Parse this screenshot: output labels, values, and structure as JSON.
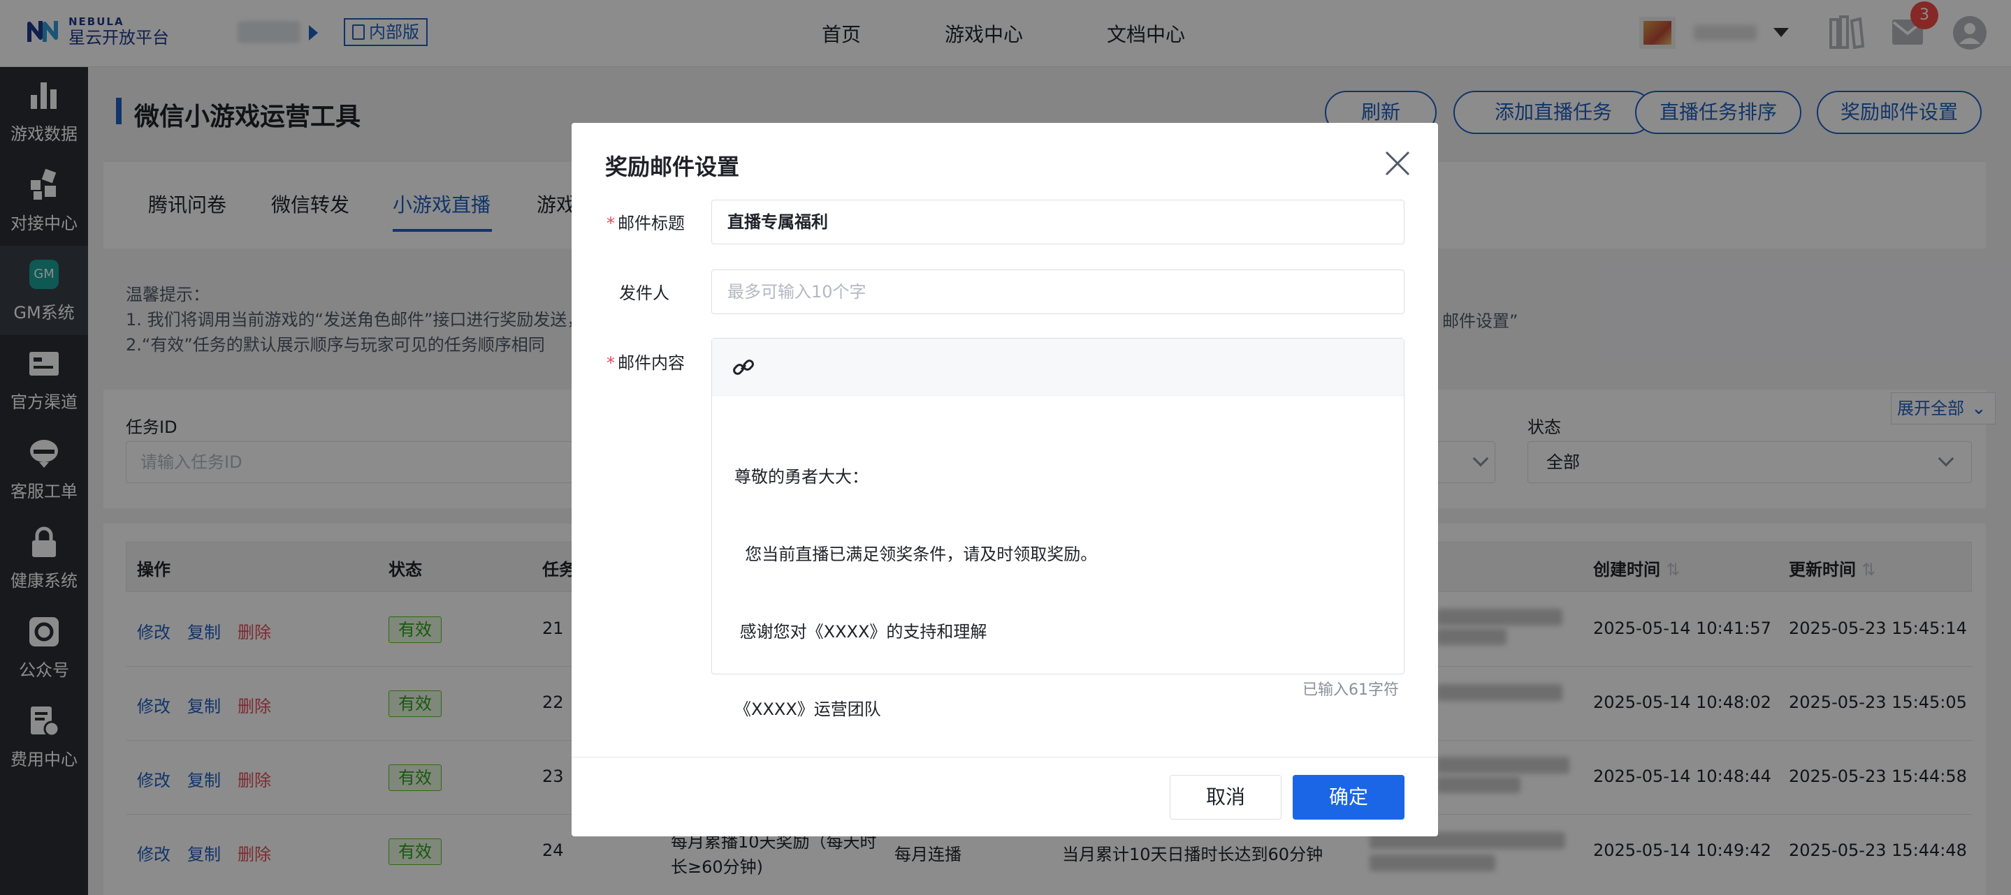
{
  "app": {
    "logo_top": "NEBULA",
    "logo_bottom": "星云开放平台",
    "badge_internal": "内部版"
  },
  "nav": [
    "首页",
    "游戏中心",
    "文档中心"
  ],
  "header": {
    "mail_count": "3"
  },
  "sidebar": {
    "items": [
      {
        "label": "游戏数据",
        "icon": "bar-chart-icon"
      },
      {
        "label": "对接中心",
        "icon": "connect-icon"
      },
      {
        "label": "GM系统",
        "icon": "gm-icon",
        "badge": "GM"
      },
      {
        "label": "官方渠道",
        "icon": "id-card-icon"
      },
      {
        "label": "客服工单",
        "icon": "customer-service-icon"
      },
      {
        "label": "健康系统",
        "icon": "lock-icon"
      },
      {
        "label": "公众号",
        "icon": "official-account-icon"
      },
      {
        "label": "费用中心",
        "icon": "billing-icon"
      }
    ]
  },
  "page": {
    "title": "微信小游戏运营工具",
    "buttons": [
      "刷新",
      "添加直播任务",
      "直播任务排序",
      "奖励邮件设置"
    ],
    "tabs": [
      "腾讯问卷",
      "微信转发",
      "小游戏直播",
      "游戏"
    ],
    "tips": {
      "title": "温馨提示：",
      "line1": "1. 我们将调用当前游戏的“发送角色邮件”接口进行奖励发送，",
      "line1_tail": "邮件设置”",
      "line2": "2.“有效”任务的默认展示顺序与玩家可见的任务顺序相同"
    },
    "filters": {
      "task_id_label": "任务ID",
      "task_id_placeholder": "请输入任务ID",
      "status_label": "状态",
      "status_value": "全部",
      "expand_all": "展开全部"
    },
    "table": {
      "headers": [
        "操作",
        "状态",
        "任务",
        "创建时间",
        "更新时间"
      ],
      "actions": [
        "修改",
        "复制",
        "删除"
      ],
      "rows": [
        {
          "status": "有效",
          "id": "21",
          "created": "2025-05-14 10:41:57",
          "updated": "2025-05-23 15:45:14"
        },
        {
          "status": "有效",
          "id": "22",
          "created": "2025-05-14 10:48:02",
          "updated": "2025-05-23 15:45:05"
        },
        {
          "status": "有效",
          "id": "23",
          "created": "2025-05-14 10:48:44",
          "updated": "2025-05-23 15:44:58"
        },
        {
          "status": "有效",
          "id": "24",
          "name_line1": "每月累播10天奖励（每天时",
          "name_line2": "长≥60分钟)",
          "type": "每月连播",
          "condition": "当月累计10天日播时长达到60分钟",
          "created": "2025-05-14 10:49:42",
          "updated": "2025-05-23 15:44:48"
        }
      ]
    }
  },
  "modal": {
    "title": "奖励邮件设置",
    "mail_title_label": "邮件标题",
    "mail_title_value": "直播专属福利",
    "sender_label": "发件人",
    "sender_placeholder": "最多可输入10个字",
    "content_label": "邮件内容",
    "content_lines": [
      "尊敬的勇者大大：",
      "  您当前直播已满足领奖条件，请及时领取奖励。",
      " 感谢您对《XXXX》的支持和理解",
      "《XXXX》运营团队"
    ],
    "char_count": "已输入61字符",
    "cancel": "取消",
    "confirm": "确定"
  },
  "colors": {
    "primary": "#1f5fbf",
    "confirm": "#1a66e6",
    "danger": "#e34d59",
    "valid": "#52c41a",
    "sidebar": "#2b2f36"
  }
}
